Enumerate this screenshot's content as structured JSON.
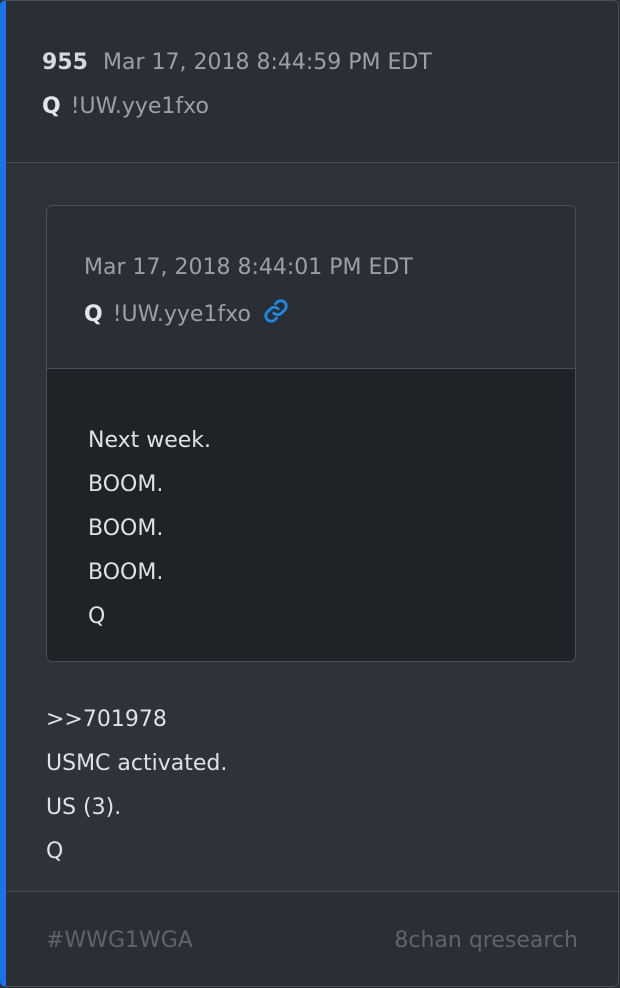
{
  "post": {
    "number": "955",
    "date": "Mar 17, 2018 8:44:59 PM EDT",
    "author": "Q",
    "tripcode": "!UW.yye1fxo",
    "lines": [
      ">>701978",
      "USMC activated.",
      "US (3).",
      "Q"
    ]
  },
  "quoted": {
    "date": "Mar 17, 2018 8:44:01 PM EDT",
    "author": "Q",
    "tripcode": "!UW.yye1fxo",
    "link_icon": "link-icon",
    "lines": [
      "Next week.",
      "BOOM.",
      "BOOM.",
      "BOOM.",
      "Q"
    ]
  },
  "footer": {
    "tag": "#WWG1WGA",
    "source": "8chan qresearch"
  },
  "colors": {
    "accent": "#1a73e8",
    "link": "#1e88e5"
  }
}
